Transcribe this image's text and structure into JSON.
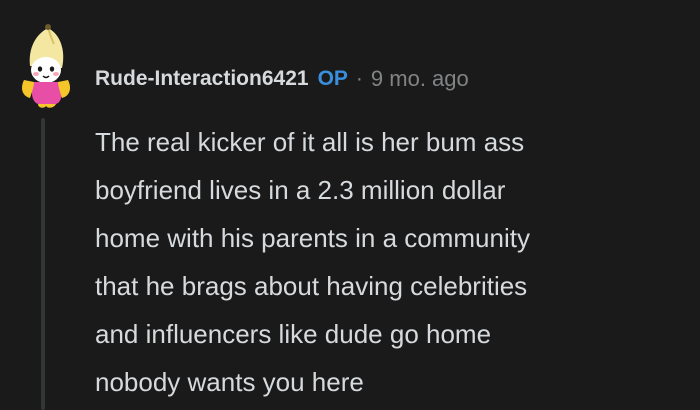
{
  "comment": {
    "author": "Rude-Interaction6421",
    "badge": "OP",
    "separator": "·",
    "timestamp": "9 mo. ago",
    "body": "The real kicker of it all is her bum ass\nboyfriend lives in a 2.3 million dollar\nhome with his parents in a community\nthat he brags about having celebrities\nand influencers like dude go home\nnobody wants you here",
    "avatar_icon": "snoo-banana-avatar-icon"
  },
  "colors": {
    "background": "#1a1a1b",
    "text": "#d7dadc",
    "muted": "#818384",
    "op_badge": "#3a8edb",
    "thread_line": "#343536"
  }
}
